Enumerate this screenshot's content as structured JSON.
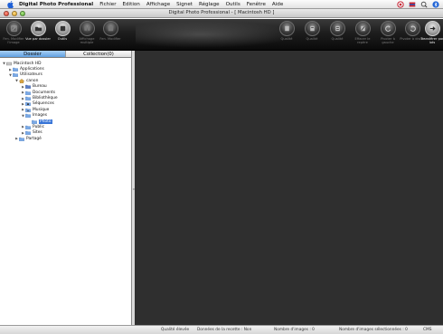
{
  "menubar": {
    "app_name": "Digital Photo Professional",
    "items": [
      "Fichier",
      "Edition",
      "Affichage",
      "Signet",
      "Réglage",
      "Outils",
      "Fenêtre",
      "Aide"
    ],
    "apple_icon": "apple-icon",
    "extras": [
      "help-icon",
      "flag-icon",
      "search-icon",
      "bluetooth-icon"
    ]
  },
  "window": {
    "title": "Digital Photo Professional - [ Macintosh HD ]"
  },
  "toolbar": {
    "buttons": [
      {
        "label": "Fen. Modifier l'image",
        "icon": "edit-image-icon",
        "active": false
      },
      {
        "label": "Vue par dossier",
        "icon": "folder-view-icon",
        "active": true
      },
      {
        "label": "Outils",
        "icon": "tools-icon",
        "active": false
      },
      {
        "label": "Affichage multiple",
        "icon": "multi-view-icon",
        "active": false
      },
      {
        "label": "Fen. Modifier",
        "icon": "edit-window-icon",
        "active": false
      },
      {
        "label": "Qualité",
        "icon": "quality-icon",
        "active": false
      },
      {
        "label": "Qualité",
        "icon": "quality2-icon",
        "active": false
      },
      {
        "label": "Qualité",
        "icon": "quality3-icon",
        "active": false
      },
      {
        "label": "Effacer le repère",
        "icon": "clear-mark-icon",
        "active": false
      },
      {
        "label": "Pivoter à gauche",
        "icon": "rotate-left-icon",
        "active": false
      },
      {
        "label": "Pivoter à droite",
        "icon": "rotate-right-icon",
        "active": false
      },
      {
        "label": "Transférer par lots",
        "icon": "batch-transfer-icon",
        "active": false
      }
    ]
  },
  "sidebar": {
    "tabs": [
      {
        "label": "Dossier",
        "active": true
      },
      {
        "label": "Collection(0)",
        "active": false
      }
    ],
    "tree": [
      {
        "label": "Macintosh HD",
        "depth": 0,
        "expanded": true,
        "icon": "drive-icon"
      },
      {
        "label": "Applications",
        "depth": 1,
        "expanded": false,
        "icon": "applications-folder-icon"
      },
      {
        "label": "Utilisateurs",
        "depth": 1,
        "expanded": true,
        "icon": "users-folder-icon"
      },
      {
        "label": "canon",
        "depth": 2,
        "expanded": true,
        "icon": "home-icon"
      },
      {
        "label": "Bureau",
        "depth": 3,
        "expanded": false,
        "icon": "desktop-folder-icon"
      },
      {
        "label": "Documents",
        "depth": 3,
        "expanded": false,
        "icon": "documents-folder-icon"
      },
      {
        "label": "Bibliothèque",
        "depth": 3,
        "expanded": false,
        "icon": "library-folder-icon"
      },
      {
        "label": "Séquences",
        "depth": 3,
        "expanded": false,
        "icon": "movies-folder-icon"
      },
      {
        "label": "Musique",
        "depth": 3,
        "expanded": false,
        "icon": "music-folder-icon"
      },
      {
        "label": "Images",
        "depth": 3,
        "expanded": true,
        "icon": "pictures-folder-icon"
      },
      {
        "label": "Photo",
        "depth": 4,
        "expanded": null,
        "icon": "folder-icon",
        "selected": true
      },
      {
        "label": "Public",
        "depth": 3,
        "expanded": false,
        "icon": "public-folder-icon"
      },
      {
        "label": "Sites",
        "depth": 3,
        "expanded": false,
        "icon": "sites-folder-icon"
      },
      {
        "label": "Partagé",
        "depth": 1,
        "expanded": false,
        "icon": "shared-folder-icon"
      }
    ]
  },
  "statusbar": {
    "quality": "Qualité élevée",
    "recipe": "Données de la recette : Non",
    "images": "Nombre d'images : 0",
    "selected": "Nombre d'images sélectionnées : 0",
    "cms": "CMS"
  },
  "colors": {
    "toolbar_bg": "#1d1d1d",
    "main_bg": "#2f2f2f",
    "tab_active": "#5f9fe0",
    "selection": "#3875d7"
  }
}
